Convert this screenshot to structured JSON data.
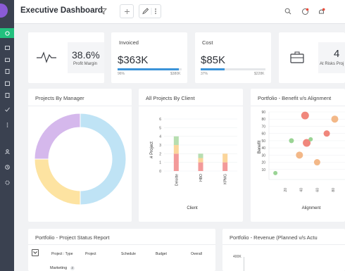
{
  "header": {
    "title": "Executive Dashboard"
  },
  "icons": {
    "filter": "filter-icon",
    "add": "plus-icon",
    "edit": "pencil-icon",
    "more": "more-vertical-icon",
    "search": "search-icon",
    "notifications": "bell-icon",
    "alerts": "alarm-icon",
    "fab": "plus-icon"
  },
  "kpis": {
    "profit": {
      "value": "38.6%",
      "label": "Profit Margin"
    },
    "invoiced": {
      "title": "Invoiced",
      "value": "$363K",
      "percent": "96%",
      "target": "$380K",
      "fill": 0.96
    },
    "cost": {
      "title": "Cost",
      "value": "$85K",
      "percent": "37%",
      "target": "$228K",
      "fill": 0.37
    },
    "risk": {
      "value": "4",
      "label": "At Risks Proj"
    }
  },
  "cards": {
    "manager": {
      "title": "Projects By Manager"
    },
    "client": {
      "title": "All Projects By Client",
      "xlabel": "Client",
      "ylabel": "# Project"
    },
    "benefit": {
      "title": "Portfolio - Benefit v/s Alignment",
      "xlabel": "Alignment",
      "ylabel": "Benefit"
    },
    "status": {
      "title": "Portfolio - Project Status Report",
      "columns": [
        "Project : Type",
        "Project",
        "Schedule",
        "Budget",
        "Overall"
      ],
      "first_row": "Marketing",
      "first_row_count": "3"
    },
    "revenue": {
      "title": "Portfolio - Revenue (Planned v/s Actu",
      "y_tick": "400K"
    }
  },
  "colors": {
    "accent": "#22c07e",
    "blue": "#3b93d8"
  },
  "chart_data": [
    {
      "type": "pie",
      "title": "Projects By Manager",
      "slices": [
        {
          "value": 50,
          "color": "#bfe3f5"
        },
        {
          "value": 25,
          "color": "#fde3a1"
        },
        {
          "value": 25,
          "color": "#d5b8ec"
        }
      ]
    },
    {
      "type": "bar",
      "title": "All Projects By Client",
      "categories": [
        "Deloitte",
        "HBO",
        "KPMG"
      ],
      "y_ticks": [
        0,
        1,
        2,
        3,
        4,
        5,
        6
      ],
      "ylim": [
        0,
        6
      ],
      "stacks": [
        [
          {
            "value": 2,
            "color": "#f39a9a"
          },
          {
            "value": 1,
            "color": "#fbd59a"
          },
          {
            "value": 1,
            "color": "#b7deb0"
          }
        ],
        [
          {
            "value": 1,
            "color": "#f39a9a"
          },
          {
            "value": 0.5,
            "color": "#fbd59a"
          },
          {
            "value": 0.5,
            "color": "#b7deb0"
          }
        ],
        [
          {
            "value": 1,
            "color": "#f39a9a"
          },
          {
            "value": 1,
            "color": "#fbd59a"
          }
        ]
      ],
      "xlabel": "Client",
      "ylabel": "# Project"
    },
    {
      "type": "scatter",
      "title": "Portfolio - Benefit v/s Alignment",
      "x_ticks": [
        20,
        40,
        60,
        80
      ],
      "y_ticks": [
        10,
        20,
        30,
        40,
        50,
        60,
        70,
        80,
        90
      ],
      "xlim": [
        0,
        100
      ],
      "ylim": [
        0,
        90
      ],
      "points": [
        {
          "x": 8,
          "y": 5,
          "r": 3,
          "color": "#8fcf8a"
        },
        {
          "x": 28,
          "y": 50,
          "r": 3.5,
          "color": "#8fcf8a"
        },
        {
          "x": 38,
          "y": 30,
          "r": 5,
          "color": "#f2b07b"
        },
        {
          "x": 45,
          "y": 85,
          "r": 5.5,
          "color": "#ee7a6e"
        },
        {
          "x": 47,
          "y": 47,
          "r": 5.5,
          "color": "#ee7a6e"
        },
        {
          "x": 52,
          "y": 52,
          "r": 3,
          "color": "#8fcf8a"
        },
        {
          "x": 60,
          "y": 20,
          "r": 4.5,
          "color": "#f2b07b"
        },
        {
          "x": 72,
          "y": 60,
          "r": 4.5,
          "color": "#ee7a6e"
        },
        {
          "x": 82,
          "y": 80,
          "r": 5,
          "color": "#f2b07b"
        }
      ],
      "xlabel": "Alignment",
      "ylabel": "Benefit"
    }
  ]
}
